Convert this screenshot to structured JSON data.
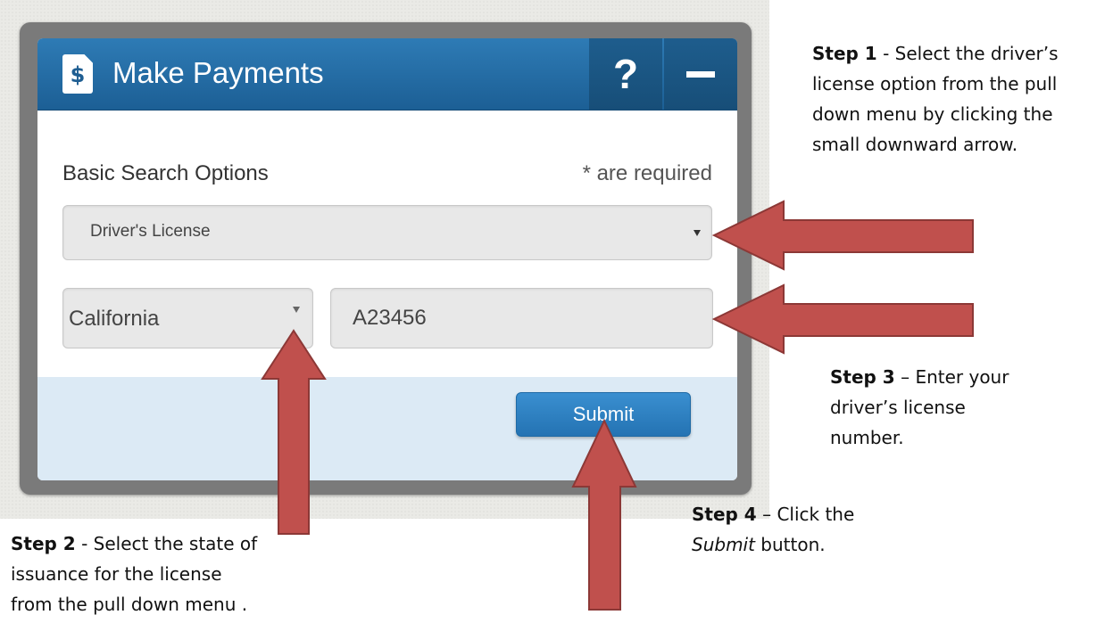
{
  "widget": {
    "title": "Make Payments",
    "icon": "dollar-document-icon",
    "icon_glyph": "$",
    "help_label": "?",
    "section_title": "Basic Search Options",
    "required_note": "* are required",
    "search_type": "Driver's License",
    "state": "California",
    "license_number": "A23456",
    "submit_label": "Submit"
  },
  "steps": {
    "step1_label": "Step 1",
    "step1_text": " - Select the driver’s license option from the pull down menu by clicking the small downward arrow.",
    "step2_label": "Step 2",
    "step2_text": " - Select the state of issuance for the license from the pull down menu .",
    "step3_label": "Step 3",
    "step3_text": " – Enter your driver’s license number.",
    "step4_label": "Step 4",
    "step4_text_before": " – Click the",
    "step4_italic": "Submit",
    "step4_text_after": " button."
  },
  "colors": {
    "header_blue": "#2e7bb5",
    "arrow_fill": "#c0504d",
    "arrow_stroke": "#8c3836",
    "footer_bg": "#dceaf5"
  }
}
